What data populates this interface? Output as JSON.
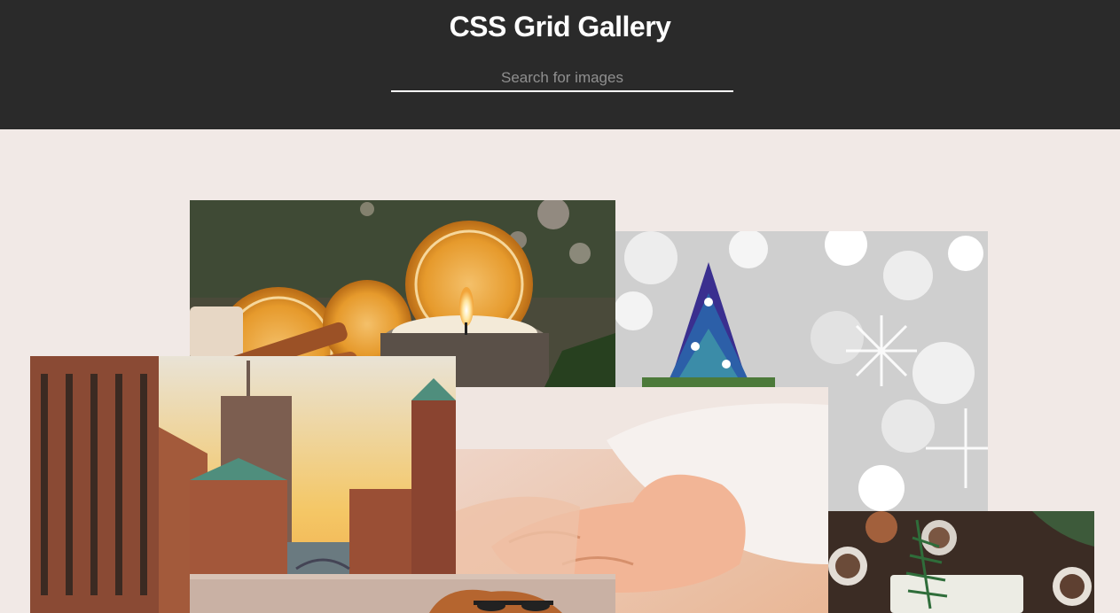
{
  "header": {
    "title": "CSS Grid Gallery",
    "search_placeholder": "Search for images"
  },
  "gallery": {
    "images": [
      {
        "subject": "dried orange slices with candle"
      },
      {
        "subject": "christmas tree ornament on bokeh"
      },
      {
        "subject": "brick warehouse canal city at sunset"
      },
      {
        "subject": "baby hand in white sleeve"
      },
      {
        "subject": "pine cones and soap gift"
      },
      {
        "subject": "dog with glasses"
      }
    ]
  },
  "colors": {
    "header_bg": "#2a2a2a",
    "page_bg": "#f1e9e6",
    "title": "#ffffff",
    "search_line": "#ffffff"
  }
}
